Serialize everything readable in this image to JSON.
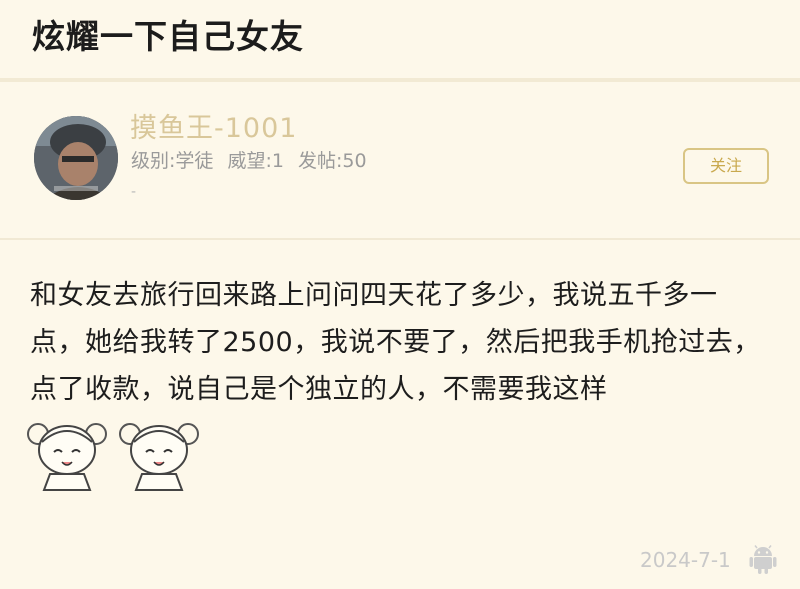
{
  "header": {
    "title": "炫耀一下自己女友"
  },
  "author": {
    "name": "摸鱼王-1001",
    "level": "级别:学徒",
    "reputation": "威望:1",
    "posts": "发帖:50",
    "extra": "-",
    "avatar_caption": "",
    "follow_label": "关注"
  },
  "post": {
    "content": "和女友去旅行回来路上问问四天花了多少，我说五千多一点，她给我转了2500，我说不要了，然后把我手机抢过去，点了收款，说自己是个独立的人，不需要我这样",
    "date": "2024-7-1",
    "device_icon": "android-icon"
  },
  "colors": {
    "background": "#fdf8ea",
    "username": "#d9c79a",
    "follow_accent": "#d9c584",
    "meta_text": "#9a9a9a"
  }
}
